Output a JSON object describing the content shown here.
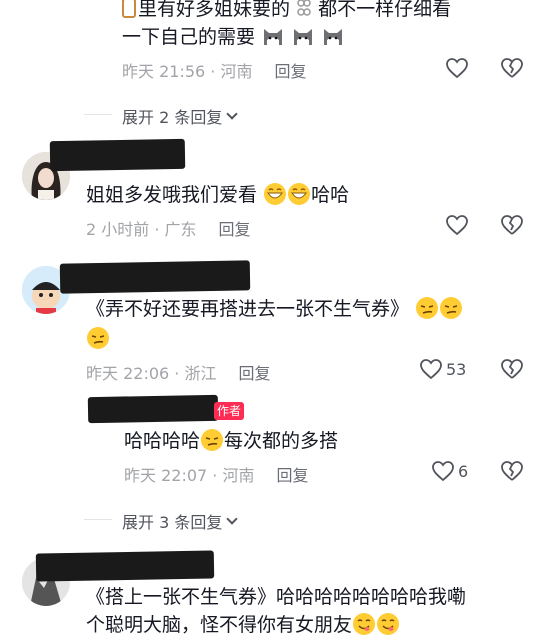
{
  "c1": {
    "line1": "里有好多姐妹要的",
    "line1b": "都不一样仔细看",
    "line2": "一下自己的需要",
    "time": "昨天 21:56 · 河南",
    "reply": "回复",
    "expand": "展开 2 条回复"
  },
  "c2": {
    "text": "姐姐多发哦我们爱看",
    "tail": "哈哈",
    "time": "2 小时前 · 广东",
    "reply": "回复"
  },
  "c3": {
    "text": "《弄不好还要再搭进去一张不生气券》",
    "time": "昨天 22:06 · 浙江",
    "reply": "回复",
    "likes": "53"
  },
  "c3r": {
    "author_tag": "作者",
    "text_a": "哈哈哈哈",
    "text_b": "每次都的多搭",
    "time": "昨天 22:07 · 河南",
    "reply": "回复",
    "likes": "6",
    "expand": "展开 3 条回复"
  },
  "c4": {
    "line1": "《搭上一张不生气券》哈哈哈哈哈哈哈哈我嘞",
    "line2": "个聪明大脑，怪不得你有女朋友"
  }
}
